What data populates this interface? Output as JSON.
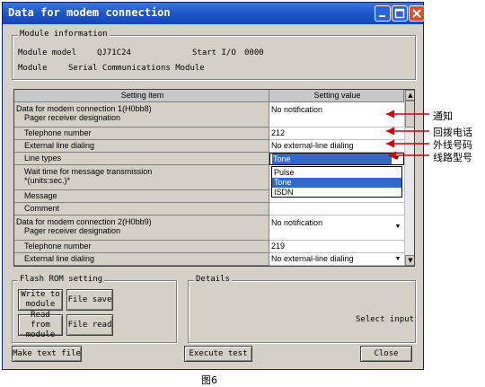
{
  "window": {
    "title": "Data for modem connection"
  },
  "module_info": {
    "title": "Module information",
    "model_label": "Module model",
    "model_value": "QJ71C24",
    "start_io_label": "Start I/O",
    "start_io_value": "0000",
    "module_label": "Module",
    "module_value": "Serial Communications Module"
  },
  "grid": {
    "headers": [
      "Setting item",
      "Setting value"
    ],
    "rows": [
      {
        "label": "Data for modem connection 1(H0bb8)",
        "label2": "Pager receiver designation",
        "value": "No notification"
      },
      {
        "label": "Telephone number",
        "value": "212"
      },
      {
        "label": "External line dialing",
        "value": "No external-line dialing"
      },
      {
        "label": "Line types",
        "value": "Tone"
      },
      {
        "label": "Wait time for message transmission",
        "label2": "*(units:sec.)*",
        "value": ""
      },
      {
        "label": "Message",
        "value": ""
      },
      {
        "label": "Comment",
        "value": ""
      },
      {
        "label": "Data for modem connection 2(H0bb9)",
        "label2": "Pager receiver designation",
        "value": "No notification"
      },
      {
        "label": "Telephone number",
        "value": "219"
      },
      {
        "label": "External line dialing",
        "value": "No external-line dialing"
      }
    ],
    "dropdown_options": [
      "Pulse",
      "Tone",
      "ISDN"
    ],
    "dropdown_selected": "Tone"
  },
  "flash_rom": {
    "title": "Flash ROM setting",
    "write_label": "Write to module",
    "file_save_label": "File save",
    "read_label": "Read from module",
    "file_read_label": "File read"
  },
  "details": {
    "title": "Details",
    "status_text": "Select input"
  },
  "buttons": {
    "make_text_file": "Make text file",
    "execute_test": "Execute test",
    "close": "Close"
  },
  "annotations": {
    "notify": "通知",
    "callback_phone": "回拨电话",
    "outside_line": "外线号码",
    "line_type": "线路型号"
  },
  "caption": "图6"
}
